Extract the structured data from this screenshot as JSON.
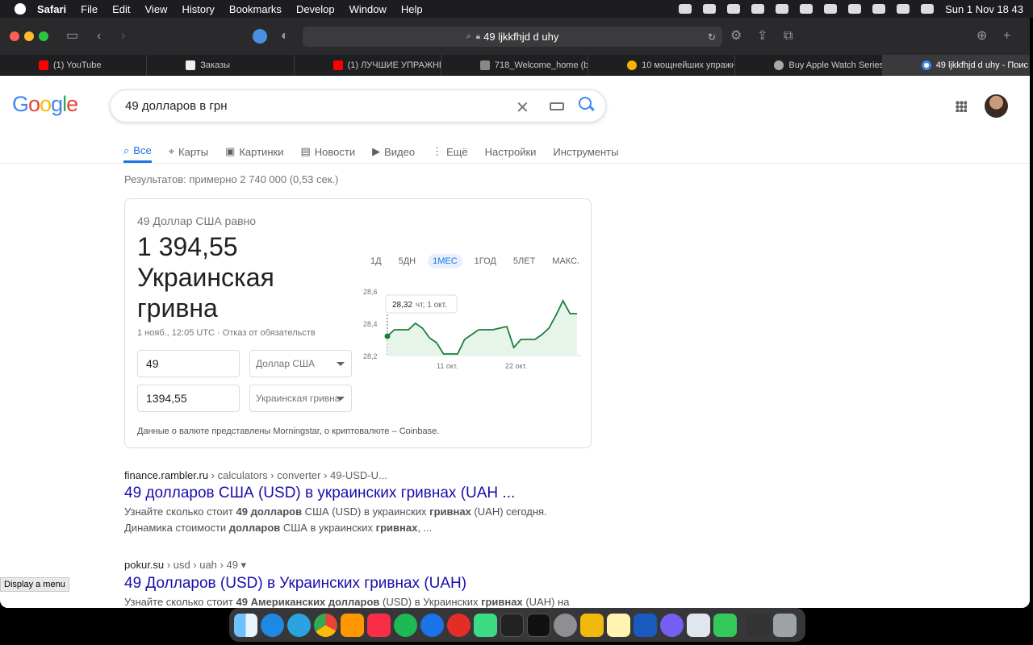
{
  "menubar": {
    "app": "Safari",
    "items": [
      "File",
      "Edit",
      "View",
      "History",
      "Bookmarks",
      "Develop",
      "Window",
      "Help"
    ],
    "clock": "Sun 1 Nov  18 43"
  },
  "browser": {
    "address": "49 ljkkfhjd d uhy",
    "tabs": [
      {
        "label": "(1) YouTube",
        "color": "#ff0000"
      },
      {
        "label": "Заказы",
        "color": "#111111"
      },
      {
        "label": "(1) ЛУЧШИЕ УПРАЖНЕ...",
        "color": "#ff0000"
      },
      {
        "label": "718_Welcome_home (bui...",
        "color": "#888888"
      },
      {
        "label": "10 мощнейших упражн...",
        "color": "#f4b400"
      },
      {
        "label": "Buy Apple Watch Series...",
        "color": "#aaaaaa"
      },
      {
        "label": "49 ljkkfhjd d uhy - Поис...",
        "color": "#4285f4"
      }
    ]
  },
  "google": {
    "query": "49 долларов в грн",
    "nav": [
      "Все",
      "Карты",
      "Картинки",
      "Новости",
      "Видео",
      "Ещё",
      "Настройки",
      "Инструменты"
    ],
    "stats": "Результатов: примерно 2 740 000 (0,53 сек.)"
  },
  "converter": {
    "equals": "49 Доллар США равно",
    "result_value": "1 394,55",
    "result_currency": "Украинская гривна",
    "meta": "1 нояб., 12:05 UTC · Отказ от обязательств",
    "from_amount": "49",
    "from_currency": "Доллар США",
    "to_amount": "1394,55",
    "to_currency": "Украинская гривна",
    "note": "Данные о валюте представлены Morningstar, о криптовалюте – Coinbase.",
    "ranges": [
      "1Д",
      "5ДН",
      "1МЕС",
      "1ГОД",
      "5ЛЕТ",
      "МАКС."
    ],
    "active_range": "1МЕС"
  },
  "chart_data": {
    "type": "area",
    "yticks": [
      "28,6",
      "28,4",
      "28,2"
    ],
    "ylim": [
      28.2,
      28.6
    ],
    "xticks": [
      "11 окт.",
      "22 окт."
    ],
    "tooltip_value": "28,32",
    "tooltip_date": "чт, 1 окт.",
    "values": [
      28.32,
      28.36,
      28.36,
      28.36,
      28.4,
      28.37,
      28.31,
      28.28,
      28.21,
      28.21,
      28.21,
      28.3,
      28.33,
      28.36,
      28.36,
      28.36,
      28.37,
      28.38,
      28.25,
      28.3,
      28.3,
      28.3,
      28.33,
      28.37,
      28.45,
      28.54,
      28.46,
      28.46
    ],
    "color": "#188038"
  },
  "results": [
    {
      "crumb_site": "finance.rambler.ru",
      "crumb_path": " › calculators › converter › 49-USD-U...",
      "title": "49 долларов США (USD) в украинских гривнах (UAH ...",
      "snippet_1": "Узнайте сколько стоит ",
      "snippet_b1": "49 долларов",
      "snippet_2": " США (USD) в украинских ",
      "snippet_b2": "гривнах",
      "snippet_3": " (UAH) сегодня.",
      "snippet_line2a": "Динамика стоимости ",
      "snippet_b3": "долларов",
      "snippet_line2b": " США в украинских ",
      "snippet_b4": "гривнах",
      "snippet_line2c": ", ..."
    },
    {
      "crumb_site": "pokur.su",
      "crumb_path": " › usd › uah › 49 ▾",
      "title": "49 Долларов (USD) в Украинских гривнах (UAH)",
      "snippet_1": "Узнайте сколько стоит ",
      "snippet_b1": "49 Американских долларов",
      "snippet_2": " (USD) в Украинских ",
      "snippet_b2": "гривнах",
      "snippet_3": " (UAH) на"
    }
  ],
  "tooltip": "Display a menu"
}
